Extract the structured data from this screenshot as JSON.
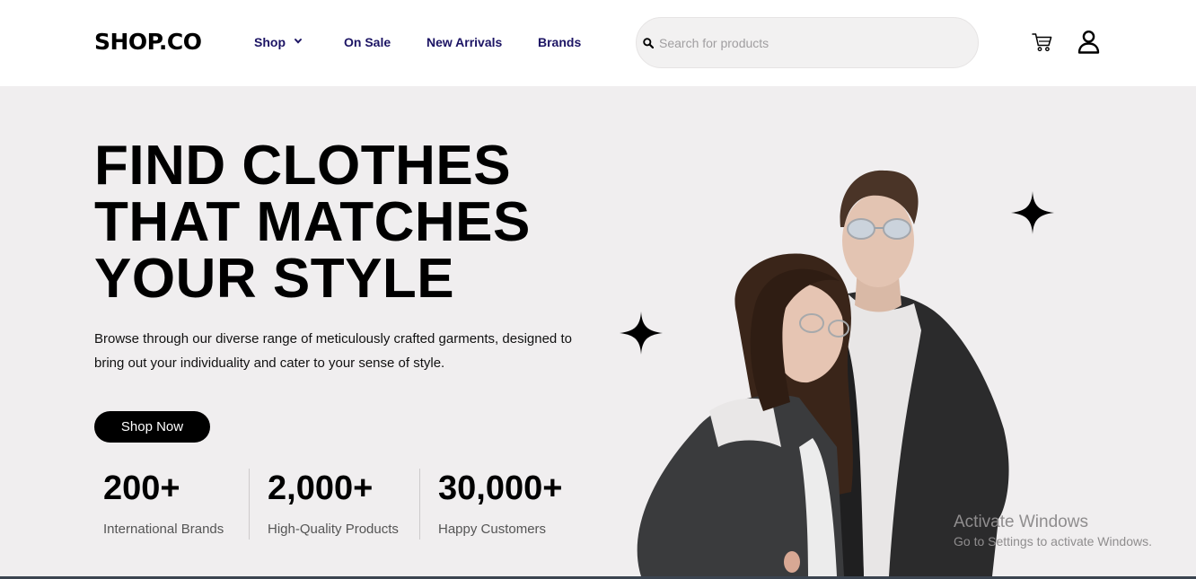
{
  "header": {
    "logo": "SHOP.CO",
    "nav": {
      "shop": "Shop",
      "on_sale": "On Sale",
      "new_arrivals": "New Arrivals",
      "brands": "Brands"
    },
    "search": {
      "placeholder": "Search for products",
      "value": ""
    },
    "icons": [
      "search-icon",
      "cart-icon",
      "user-icon",
      "chevron-down-icon"
    ]
  },
  "hero": {
    "headline": [
      "FIND CLOTHES",
      "THAT MATCHES",
      "YOUR STYLE"
    ],
    "subtext_line1": "Browse through our diverse range of meticulously crafted garments, designed to",
    "subtext_line2": "bring out your individuality and cater to your sense of style.",
    "cta": "Shop Now",
    "stats": [
      {
        "value": "200+",
        "label": "International Brands"
      },
      {
        "value": "2,000+",
        "label": "High-Quality Products"
      },
      {
        "value": "30,000+",
        "label": "Happy Customers"
      }
    ]
  },
  "overlay": {
    "title": "Activate Windows",
    "subtitle": "Go to Settings to activate Windows."
  },
  "colors": {
    "nav_text": "#1c1464",
    "hero_bg": "#f0eeef",
    "button_bg": "#000000",
    "search_bg": "#f2f1f1"
  }
}
